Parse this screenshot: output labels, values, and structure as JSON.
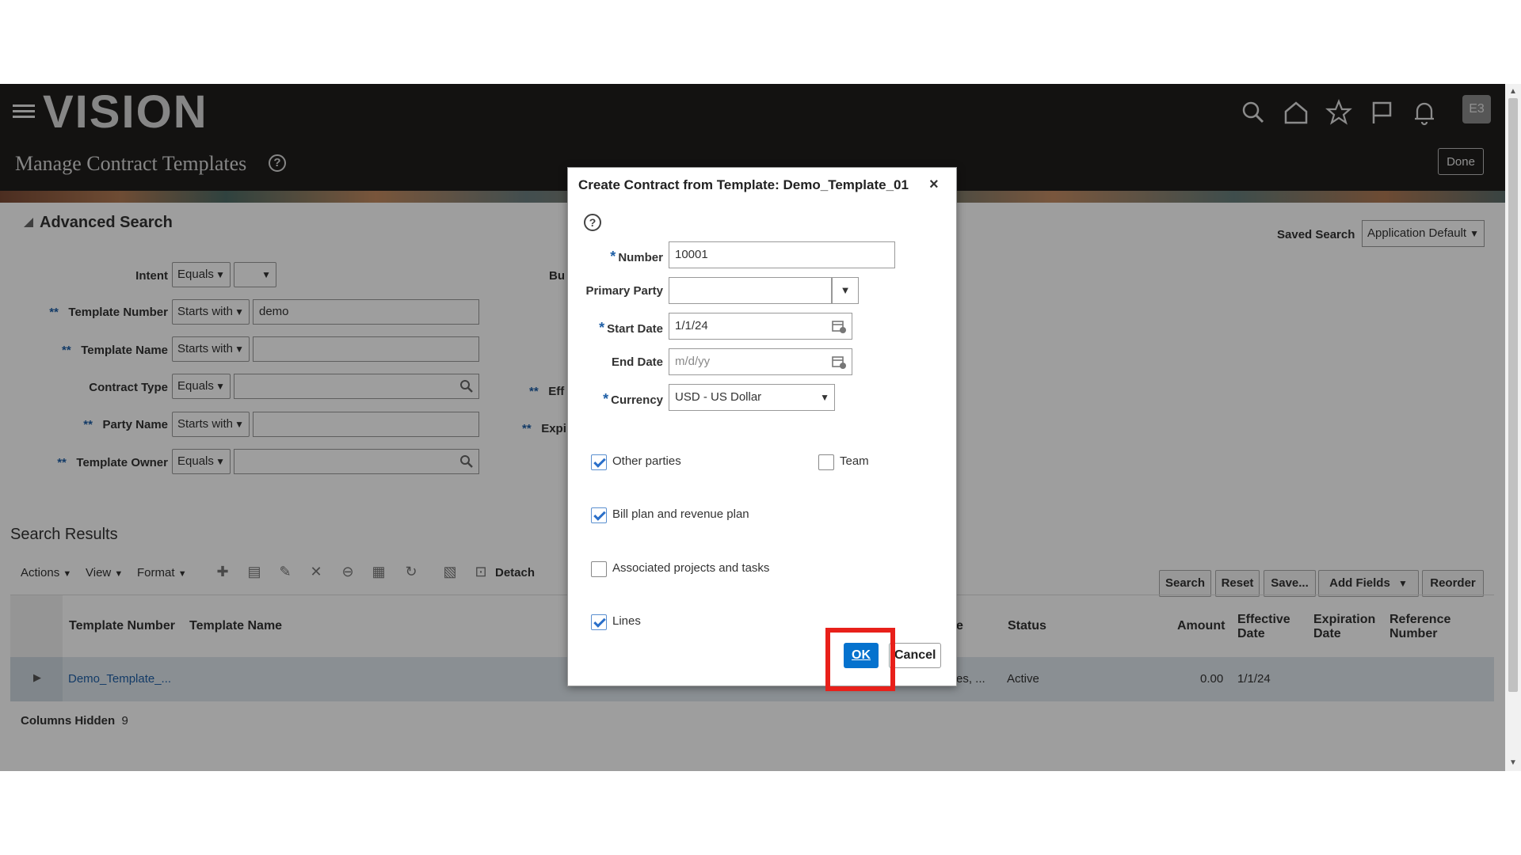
{
  "header": {
    "logo": "VISION",
    "page_title": "Manage Contract Templates",
    "help_glyph": "?",
    "user_initials": "E3",
    "done_label": "Done",
    "icons": [
      "search-icon",
      "home-icon",
      "star-icon",
      "flag-icon",
      "bell-icon"
    ]
  },
  "search": {
    "title": "Advanced Search",
    "saved_search_label": "Saved Search",
    "saved_search_value": "Application Default",
    "fields": {
      "intent": {
        "label": "Intent",
        "operator": "Equals",
        "value": ""
      },
      "template_number": {
        "label": "Template Number",
        "operator": "Starts with",
        "value": "demo"
      },
      "template_name": {
        "label": "Template Name",
        "operator": "Starts with",
        "value": ""
      },
      "contract_type": {
        "label": "Contract Type",
        "operator": "Equals",
        "value": ""
      },
      "party_name": {
        "label": "Party Name",
        "operator": "Starts with",
        "value": ""
      },
      "template_owner": {
        "label": "Template Owner",
        "operator": "Equals",
        "value": ""
      }
    },
    "req_marker": "**",
    "partial_labels": {
      "bu": "Bu",
      "eff": "Eff",
      "exp": "Expi"
    },
    "buttons": {
      "search": "Search",
      "reset": "Reset",
      "save": "Save...",
      "add_fields": "Add Fields",
      "reorder": "Reorder"
    }
  },
  "results": {
    "title": "Search Results",
    "toolbar": {
      "actions": "Actions",
      "view": "View",
      "format": "Format",
      "detach": "Detach"
    },
    "columns": {
      "template_number": "Template Number",
      "template_name": "Template Name",
      "partial": "e",
      "status": "Status",
      "amount": "Amount",
      "effective_date": "Effective Date",
      "expiration_date": "Expiration Date",
      "reference_number": "Reference Number"
    },
    "row": {
      "template_number": "Demo_Template_...",
      "partial": "es, ...",
      "status": "Active",
      "amount": "0.00",
      "effective_date": "1/1/24"
    },
    "columns_hidden_label": "Columns Hidden",
    "columns_hidden_count": "9"
  },
  "dialog": {
    "title": "Create Contract from Template: Demo_Template_01",
    "close_glyph": "×",
    "help_glyph": "?",
    "req_star": "*",
    "fields": {
      "number": {
        "label": "Number",
        "value": "10001"
      },
      "primary_party": {
        "label": "Primary Party",
        "value": ""
      },
      "start_date": {
        "label": "Start Date",
        "value": "1/1/24"
      },
      "end_date": {
        "label": "End Date",
        "placeholder": "m/d/yy"
      },
      "currency": {
        "label": "Currency",
        "value": "USD - US Dollar"
      }
    },
    "checkboxes": {
      "other_parties": {
        "label": "Other parties",
        "checked": true
      },
      "team": {
        "label": "Team",
        "checked": false
      },
      "bill_plan": {
        "label": "Bill plan and revenue plan",
        "checked": true
      },
      "projects": {
        "label": "Associated projects and tasks",
        "checked": false
      },
      "lines": {
        "label": "Lines",
        "checked": true
      }
    },
    "ok_label": "OK",
    "cancel_label": "Cancel"
  },
  "colors": {
    "header_bg": "#201e1c",
    "primary_button": "#0572ce",
    "highlight": "#e8201a",
    "row_selected": "#dfe7ee"
  }
}
